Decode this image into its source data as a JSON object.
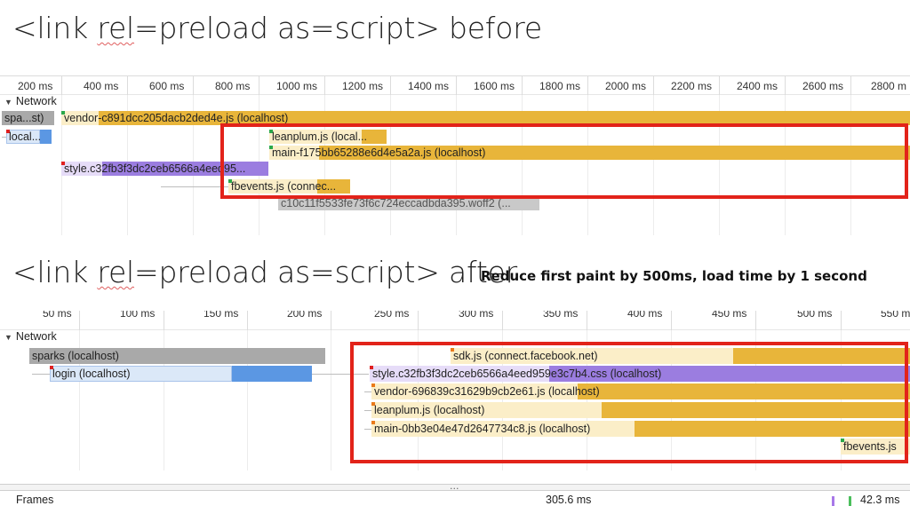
{
  "slide": {
    "title_before_pre": "<link ",
    "title_before_sq": "rel",
    "title_before_post": "=preload as=script> before",
    "title_after_pre": "<link ",
    "title_after_sq": "rel",
    "title_after_post": "=preload as=script> after",
    "subtitle": "Reduce first paint by 500ms, load time by 1 second"
  },
  "colors": {
    "script": "#e8b53a",
    "script_light": "#fbeec8",
    "stylesheet": "#9b7de0",
    "stylesheet_light": "#e6dcf8",
    "document": "#5b97e3",
    "document_light": "#dbe8f8",
    "other": "#a9a9a9",
    "highlight": "#e2231a"
  },
  "before": {
    "ticks": [
      "200 ms",
      "400 ms",
      "600 ms",
      "800 ms",
      "1000 ms",
      "1200 ms",
      "1400 ms",
      "1600 ms",
      "1800 ms",
      "2000 ms",
      "2200 ms",
      "2400 ms",
      "2600 ms",
      "2800 m"
    ],
    "section_label": "Network",
    "requests": [
      {
        "label": "spa...st)",
        "type": "other"
      },
      {
        "label": "vendor-c891dcc205dacb2ded4e.js (localhost)",
        "type": "script"
      },
      {
        "label": "local...",
        "type": "document"
      },
      {
        "label": "leanplum.js (local...",
        "type": "script"
      },
      {
        "label": "main-f175bb65288e6d4e5a2a.js (localhost)",
        "type": "script"
      },
      {
        "label": "style.c32fb3f3dc2ceb6566a4eed95...",
        "type": "stylesheet"
      },
      {
        "label": "fbevents.js (connec...",
        "type": "script"
      },
      {
        "label": "c10c11f5533fe73f6c724eccadbda395.woff2 (...",
        "type": "other"
      }
    ]
  },
  "after": {
    "ticks": [
      "50 ms",
      "100 ms",
      "150 ms",
      "200 ms",
      "250 ms",
      "300 ms",
      "350 ms",
      "400 ms",
      "450 ms",
      "500 ms",
      "550 m"
    ],
    "section_label": "Network",
    "requests": [
      {
        "label": "sparks (localhost)",
        "type": "other"
      },
      {
        "label": "sdk.js (connect.facebook.net)",
        "type": "script"
      },
      {
        "label": "login (localhost)",
        "type": "document"
      },
      {
        "label": "style.c32fb3f3dc2ceb6566a4eed959e3c7b4.css (localhost)",
        "type": "stylesheet"
      },
      {
        "label": "vendor-696839c31629b9cb2e61.js (localhost)",
        "type": "script"
      },
      {
        "label": "leanplum.js (localhost)",
        "type": "script"
      },
      {
        "label": "main-0bb3e04e47d2647734c8.js (localhost)",
        "type": "script"
      },
      {
        "label": "fbevents.js",
        "type": "script"
      }
    ]
  },
  "frames": {
    "label": "Frames",
    "time": "305.6 ms",
    "time2": "42.3 ms",
    "handle": "..."
  }
}
